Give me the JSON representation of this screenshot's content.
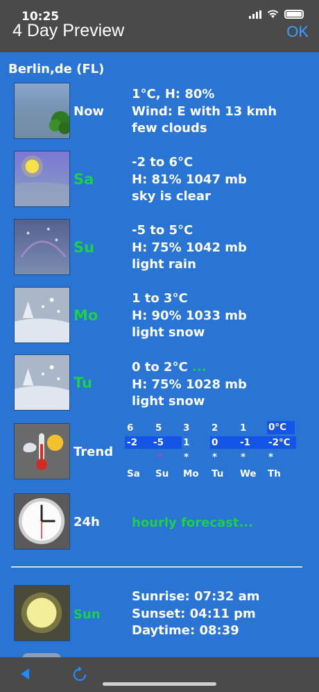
{
  "status": {
    "time": "10:25"
  },
  "header": {
    "title": "4 Day Preview",
    "ok_label": "OK"
  },
  "location": "Berlin,de (FL)",
  "forecast": [
    {
      "day": "Now",
      "line1": "1°C, H: 80%",
      "line2": "Wind: E with 13 kmh",
      "line3": "few clouds",
      "icon": "cloudy-tree-icon"
    },
    {
      "day": "Sa",
      "line1": "-2 to 6°C",
      "line2": "H: 81% 1047 mb",
      "line3": "sky is clear",
      "icon": "sunny-icon"
    },
    {
      "day": "Su",
      "line1": "-5 to 5°C",
      "line2": "H: 75% 1042 mb",
      "line3": "light rain",
      "icon": "rain-icon"
    },
    {
      "day": "Mo",
      "line1": "1 to 3°C",
      "line2": "H: 90% 1033 mb",
      "line3": "light snow",
      "icon": "snow-icon"
    },
    {
      "day": "Tu",
      "line1": "0 to 2°C",
      "line1_extra": "...",
      "line2": "H: 75% 1028 mb",
      "line3": "light snow",
      "icon": "snow-icon"
    }
  ],
  "trend": {
    "label": "Trend",
    "highs": [
      "6",
      "5",
      "3",
      "2",
      "1",
      "0°C"
    ],
    "lows": [
      "-2",
      "-5",
      "1",
      "0",
      "-1",
      "-2°C"
    ],
    "days": [
      "Sa",
      "Su",
      "Mo",
      "Tu",
      "We",
      "Th"
    ],
    "symbols": [
      "",
      "☂",
      "*",
      "*",
      "*",
      "*"
    ]
  },
  "hourly": {
    "label": "24h",
    "link": "hourly forecast..."
  },
  "sun": {
    "day": "Sun",
    "sunrise": "Sunrise: 07:32 am",
    "sunset": "Sunset: 04:11 pm",
    "daytime": "Daytime: 08:39"
  },
  "colors": {
    "background": "#2a74d4",
    "header": "#4a4a4a",
    "accent_green": "#1ecf4a",
    "ok_blue": "#3aa0ff"
  }
}
